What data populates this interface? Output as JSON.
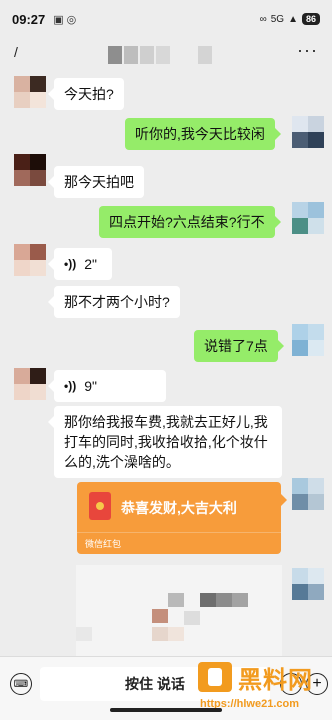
{
  "status_bar": {
    "time": "09:27",
    "battery": "86",
    "signal": "5G"
  },
  "nav": {
    "back_icon": "back-icon",
    "more_icon": "more-icon"
  },
  "messages": {
    "m1": "今天拍?",
    "m2": "听你的,我今天比较闲",
    "m3": "那今天拍吧",
    "m4": "四点开始?六点结束?行不",
    "m5_duration": "2\"",
    "m6": "那不才两个小时?",
    "m7": "说错了7点",
    "m8_duration": "9\"",
    "m9": "那你给我报车费,我就去正好儿,我打车的同时,我收拾收拾,化个妆什么的,洗个澡啥的。"
  },
  "red_packet": {
    "text": "恭喜发财,大吉大利",
    "footer": "微信红包"
  },
  "bottom_bar": {
    "hold_to_talk": "按住 说话"
  },
  "watermark": {
    "name": "黑料网",
    "url": "https://hlwe21.com"
  },
  "colors": {
    "incoming_bubble": "#ffffff",
    "outgoing_bubble": "#95ec69",
    "red_packet": "#f79c3b",
    "background": "#ededed"
  }
}
